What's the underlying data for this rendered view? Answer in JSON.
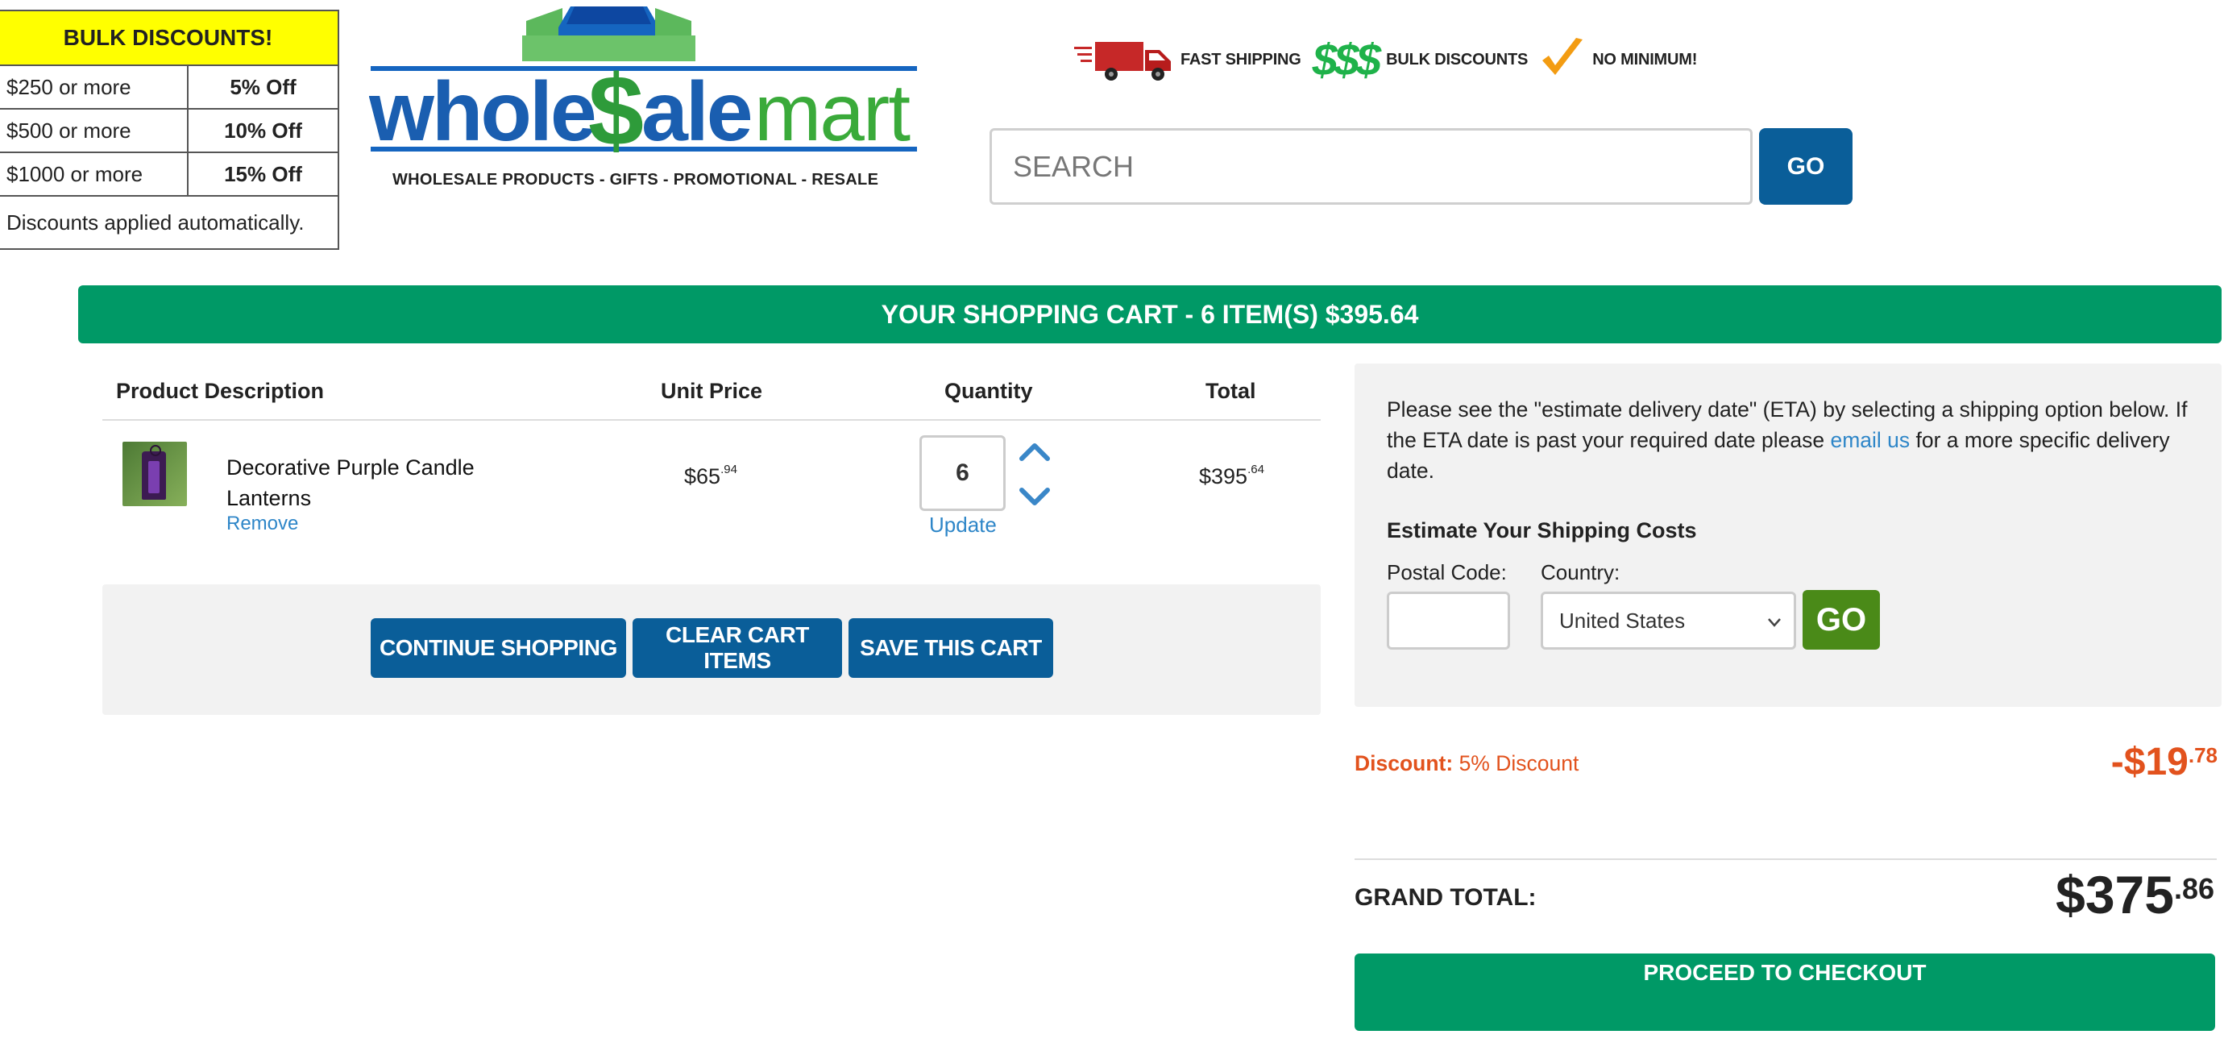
{
  "bulk_discounts": {
    "title": "BULK DISCOUNTS!",
    "tiers": [
      {
        "amount": "$250 or more",
        "discount": "5% Off"
      },
      {
        "amount": "$500 or more",
        "discount": "10% Off"
      },
      {
        "amount": "$1000 or more",
        "discount": "15% Off"
      }
    ],
    "note": "Discounts applied automatically."
  },
  "logo": {
    "brand_left": "whole",
    "brand_dollar": "$",
    "brand_mid": "ale",
    "brand_right": "mart",
    "tagline": "WHOLESALE PRODUCTS - GIFTS - PROMOTIONAL - RESALE"
  },
  "benefits": {
    "shipping": "FAST SHIPPING",
    "bulk_symbol": "$$$",
    "bulk": "BULK DISCOUNTS",
    "minimum": "NO MINIMUM!"
  },
  "search": {
    "placeholder": "SEARCH",
    "go_label": "GO"
  },
  "cart": {
    "banner": "YOUR SHOPPING CART - 6 ITEM(S) $395.64",
    "headers": {
      "description": "Product Description",
      "unit_price": "Unit Price",
      "quantity": "Quantity",
      "total": "Total"
    },
    "items": [
      {
        "name": "Decorative Purple Candle Lanterns",
        "remove_label": "Remove",
        "unit_price_main": "$65",
        "unit_price_cents": ".94",
        "quantity": "6",
        "update_label": "Update",
        "total_main": "$395",
        "total_cents": ".64"
      }
    ],
    "actions": {
      "continue": "CONTINUE SHOPPING",
      "clear": "CLEAR CART ITEMS",
      "save": "SAVE THIS CART"
    }
  },
  "shipping": {
    "note_before": "Please see the \"estimate delivery date\" (ETA) by selecting a shipping option below. If the ETA date is past your required date please ",
    "note_link": "email us",
    "note_after": " for a more specific delivery date.",
    "heading": "Estimate Your Shipping Costs",
    "postal_label": "Postal Code:",
    "postal_value": "",
    "country_label": "Country:",
    "country_value": "United States",
    "go_label": "GO"
  },
  "totals": {
    "discount_label": "Discount:",
    "discount_desc": "5% Discount",
    "discount_main": "-$19",
    "discount_cents": ".78",
    "grand_label": "GRAND TOTAL:",
    "grand_main": "$375",
    "grand_cents": ".86",
    "checkout_label": "PROCEED TO CHECKOUT"
  },
  "colors": {
    "brand_blue": "#0a5e99",
    "brand_green": "#009966",
    "go_green": "#4a8a18",
    "discount_orange": "#e2521d",
    "link_blue": "#2e86c8",
    "bulk_yellow": "#ffff00"
  },
  "icons": [
    "truck-icon",
    "check-icon",
    "chevron-up-icon",
    "chevron-down-icon",
    "select-chevron-icon",
    "logo-building-icon"
  ]
}
